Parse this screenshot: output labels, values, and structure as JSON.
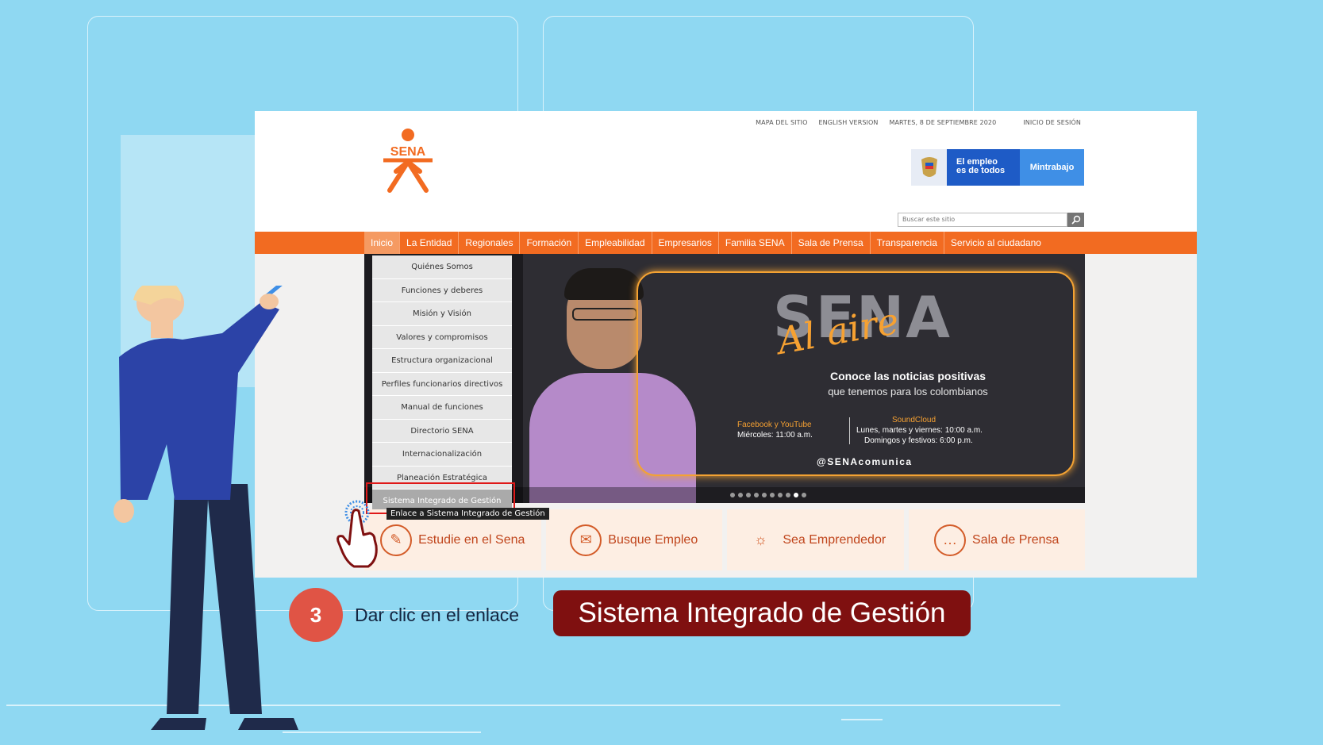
{
  "utility_bar": {
    "sitemap": "MAPA DEL SITIO",
    "english": "ENGLISH VERSION",
    "date": "MARTES, 8 DE SEPTIEMBRE 2020",
    "login": "INICIO DE SESIÓN"
  },
  "logo": {
    "text": "SENA"
  },
  "gov_banner": {
    "line1": "El empleo",
    "line2": "es de todos",
    "ministry": "Mintrabajo"
  },
  "search": {
    "placeholder": "Buscar este sitio"
  },
  "nav": [
    {
      "label": "Inicio"
    },
    {
      "label": "La Entidad"
    },
    {
      "label": "Regionales"
    },
    {
      "label": "Formación"
    },
    {
      "label": "Empleabilidad"
    },
    {
      "label": "Empresarios"
    },
    {
      "label": "Familia SENA"
    },
    {
      "label": "Sala de Prensa"
    },
    {
      "label": "Transparencia"
    },
    {
      "label": "Servicio al ciudadano"
    }
  ],
  "dropdown": [
    {
      "label": "Quiénes Somos"
    },
    {
      "label": "Funciones y deberes"
    },
    {
      "label": "Misión y Visión"
    },
    {
      "label": "Valores y compromisos"
    },
    {
      "label": "Estructura organizacional"
    },
    {
      "label": "Perfiles funcionarios directivos"
    },
    {
      "label": "Manual de funciones"
    },
    {
      "label": "Directorio SENA"
    },
    {
      "label": "Internacionalización"
    },
    {
      "label": "Planeación Estratégica"
    },
    {
      "label": "Sistema Integrado de Gestión"
    }
  ],
  "tooltip": "Enlace a Sistema Integrado de Gestión",
  "hero": {
    "brand": "SENA",
    "tagline": "Al aire",
    "headline": "Conoce las noticias positivas",
    "subline": "que tenemos para los colombianos",
    "fb_label": "Facebook y YouTube",
    "fb_time": "Miércoles: 11:00 a.m.",
    "sc_label": "SoundCloud",
    "sc_time1": "Lunes, martes y viernes: 10:00 a.m.",
    "sc_time2": "Domingos y festivos: 6:00 p.m.",
    "handle": "@SENAcomunica",
    "slide_count": 10,
    "active_slide": 9
  },
  "cards": [
    {
      "label": "Estudie en el Sena",
      "icon": "pencil-icon"
    },
    {
      "label": "Busque Empleo",
      "icon": "briefcase-icon"
    },
    {
      "label": "Sea Emprendedor",
      "icon": "lightbulb-icon"
    },
    {
      "label": "Sala de Prensa",
      "icon": "chat-bubble-icon"
    }
  ],
  "instruction": {
    "step": "3",
    "text": "Dar clic en el enlace",
    "highlight": "Sistema Integrado de Gestión"
  },
  "colors": {
    "nav_orange": "#f26b21",
    "highlight_red": "#e01919",
    "pill": "#7f1010",
    "step_circle": "#e05445"
  }
}
